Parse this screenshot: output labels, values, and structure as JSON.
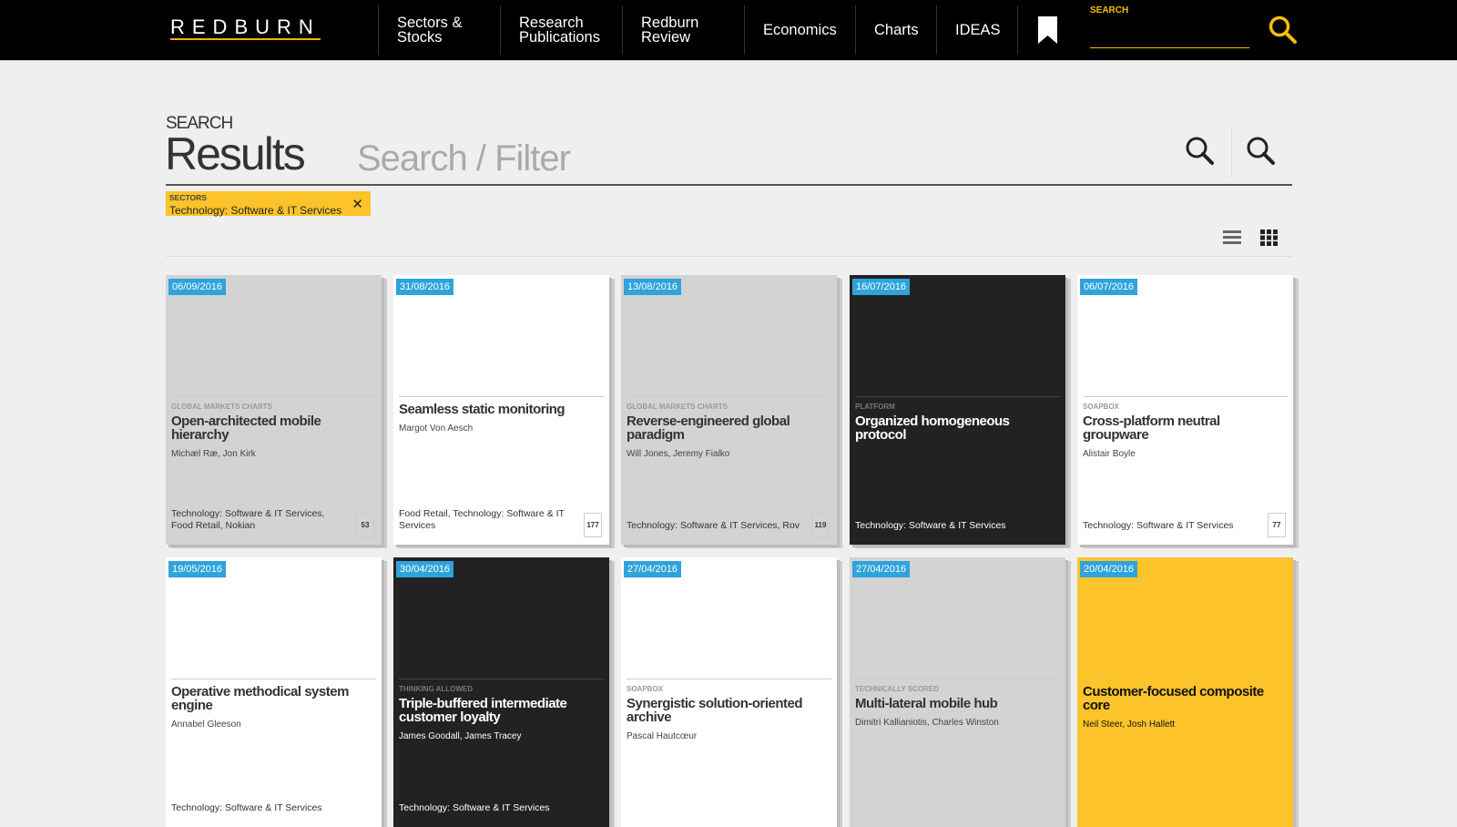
{
  "nav": {
    "logo": "REDBURN",
    "items": [
      "Sectors & Stocks",
      "Research Publications",
      "Redburn Review",
      "Economics",
      "Charts",
      "IDEAS"
    ],
    "search_label": "SEARCH"
  },
  "search": {
    "label": "SEARCH",
    "title": "Results",
    "placeholder": "Search / Filter"
  },
  "filter_tag": {
    "key": "SECTORS",
    "value": "Technology: Software & IT Services",
    "remove": "✕"
  },
  "colors": {
    "accent": "#fcc42a",
    "date_badge": "#2ea3dc",
    "dark": "#222222"
  },
  "cards": [
    {
      "date": "06/09/2016",
      "category": "GLOBAL MARKETS CHARTS",
      "title": "Open-architected mobile hierarchy",
      "authors": "Michæl Ræ, Jon Kirk",
      "sectors": "Technology: Software & IT Services, Food Retail, Nokian",
      "count": "53",
      "theme": "grey"
    },
    {
      "date": "31/08/2016",
      "category": "",
      "title": "Seamless static monitoring",
      "authors": "Margot Von Aesch",
      "sectors": "Food Retail, Technology: Software & IT Services",
      "count": "177",
      "theme": "white"
    },
    {
      "date": "13/08/2016",
      "category": "GLOBAL MARKETS CHARTS",
      "title": "Reverse-engineered global paradigm",
      "authors": "Will Jones, Jeremy Fialko",
      "sectors": "Technology: Software & IT Services, Rov",
      "count": "119",
      "theme": "grey"
    },
    {
      "date": "16/07/2016",
      "category": "PLATFORM",
      "title": "Organized homogeneous protocol",
      "authors": "",
      "sectors": "Technology: Software & IT Services",
      "count": "",
      "theme": "dark"
    },
    {
      "date": "06/07/2016",
      "category": "SOAPBOX",
      "title": "Cross-platform neutral groupware",
      "authors": "Alistair Boyle",
      "sectors": "Technology: Software & IT Services",
      "count": "77",
      "theme": "white"
    },
    {
      "date": "19/05/2016",
      "category": "",
      "title": "Operative methodical system engine",
      "authors": "Annabel Gleeson",
      "sectors": "Technology: Software & IT Services",
      "count": "",
      "theme": "white"
    },
    {
      "date": "30/04/2016",
      "category": "THINKING ALLOWED",
      "title": "Triple-buffered intermediate customer loyalty",
      "authors": "James Goodall, James Tracey",
      "sectors": "Technology: Software & IT Services",
      "count": "",
      "theme": "dark"
    },
    {
      "date": "27/04/2016",
      "category": "SOAPBOX",
      "title": "Synergistic solution-oriented archive",
      "authors": "Pascal Hautcœur",
      "sectors": "",
      "count": "",
      "theme": "white"
    },
    {
      "date": "27/04/2016",
      "category": "TECHNICALLY SCORED",
      "title": "Multi-lateral mobile hub",
      "authors": "Dimitri Kallianiotis, Charles Winston",
      "sectors": "",
      "count": "",
      "theme": "grey"
    },
    {
      "date": "20/04/2016",
      "category": "",
      "title": "Customer-focused composite core",
      "authors": "Neil Steer, Josh Hallett",
      "sectors": "",
      "count": "",
      "theme": "yellow"
    }
  ]
}
